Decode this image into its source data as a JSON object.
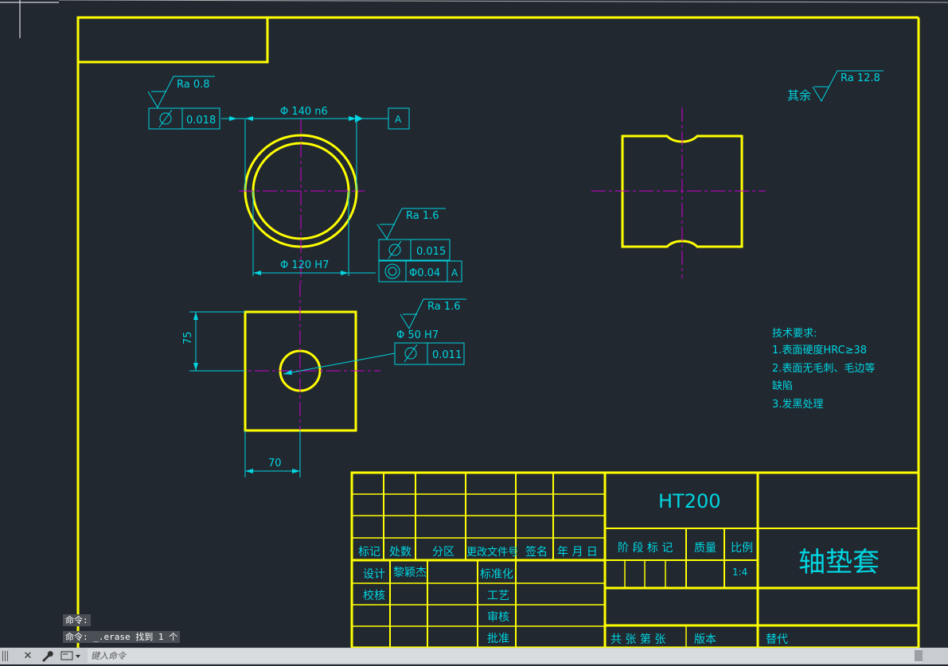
{
  "drawing": {
    "border_text": [],
    "front_view": {
      "roughness_top": "Ra  0.8",
      "tolerance_top": "0.018",
      "dim_outer": "Φ 140 n6",
      "datum": "A",
      "dim_inner": "Φ 120 H7",
      "roughness_mid": "Ra  1.6",
      "tolerance_flat": "0.015",
      "tolerance_coax_value": "Φ0.04",
      "tolerance_coax_datum": "A"
    },
    "side_view": {
      "roughness_rest_label": "其余",
      "roughness_rest_value": "Ra  12.8"
    },
    "bottom_view": {
      "dim_height": "75",
      "dim_width": "70",
      "roughness": "Ra  1.6",
      "dim_hole": "Φ 50 H7",
      "tolerance": "0.011"
    },
    "tech_requirements": {
      "title": "技术要求:",
      "lines": [
        "1.表面硬度HRC≥38",
        "2.表面无毛刺、毛边等",
        "缺陷",
        "3.发黑处理"
      ]
    },
    "title_block": {
      "material": "HT200",
      "part_name": "轴垫套",
      "h_mark": "标记",
      "h_count": "处数",
      "h_zone": "分区",
      "h_docno": "更改文件号",
      "h_sign": "签名",
      "h_date": "年 月 日",
      "r_design": "设计",
      "r_designer": "黎颖杰",
      "r_standard": "标准化",
      "r_check": "校核",
      "r_process": "工艺",
      "r_review": "审核",
      "r_approve": "批准",
      "stage_mark": "阶 段 标 记",
      "weight": "质量",
      "scale_label": "比例",
      "scale_value": "1:4",
      "sheets": "共  张 第  张",
      "version": "版本",
      "replace": "替代"
    }
  },
  "command_history": [
    "命令:",
    "命令: _.erase 找到 1 个"
  ],
  "command_line": {
    "placeholder": "键入命令"
  },
  "colors": {
    "background": "#212830",
    "yellow": "#ffff00",
    "cyan": "#00d5e0",
    "magenta": "#d000d0"
  }
}
